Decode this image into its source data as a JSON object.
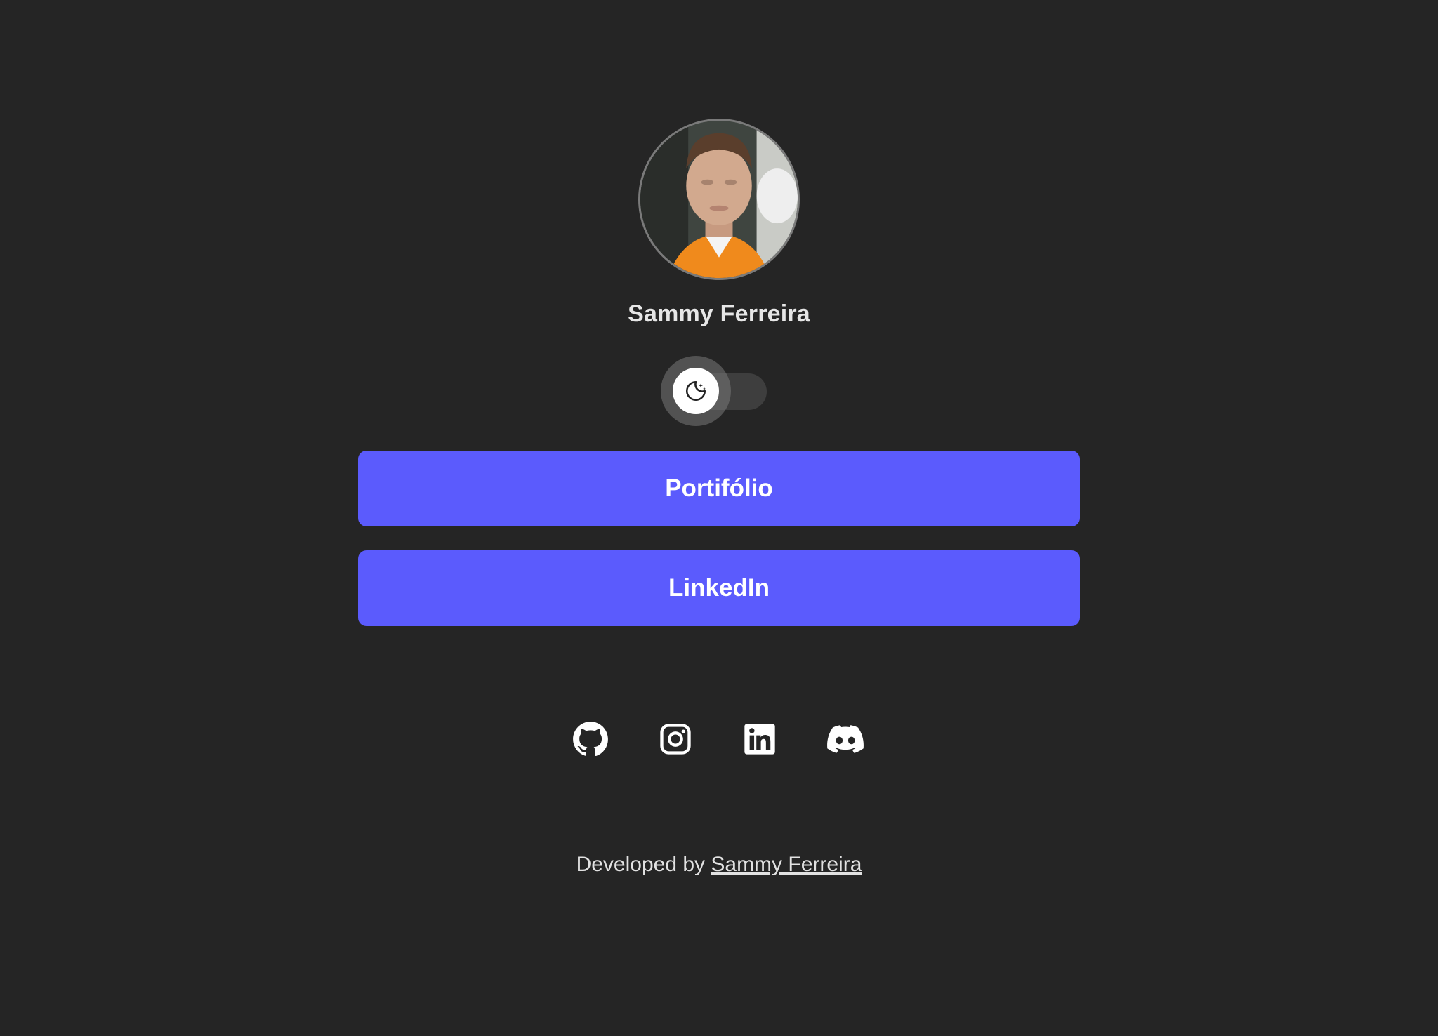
{
  "profile": {
    "name": "Sammy Ferreira",
    "avatar_alt": "profile photo"
  },
  "theme_toggle": {
    "icon": "moon-icon",
    "state": "off"
  },
  "links": [
    {
      "label": "Portifólio"
    },
    {
      "label": "LinkedIn"
    }
  ],
  "social": [
    {
      "icon": "github-icon"
    },
    {
      "icon": "instagram-icon"
    },
    {
      "icon": "linkedin-icon"
    },
    {
      "icon": "discord-icon"
    }
  ],
  "footer": {
    "prefix": "Developed by ",
    "author_link": "Sammy Ferreira"
  },
  "colors": {
    "background": "#252525",
    "accent": "#5b5bfd",
    "text": "#e6e6e6"
  }
}
